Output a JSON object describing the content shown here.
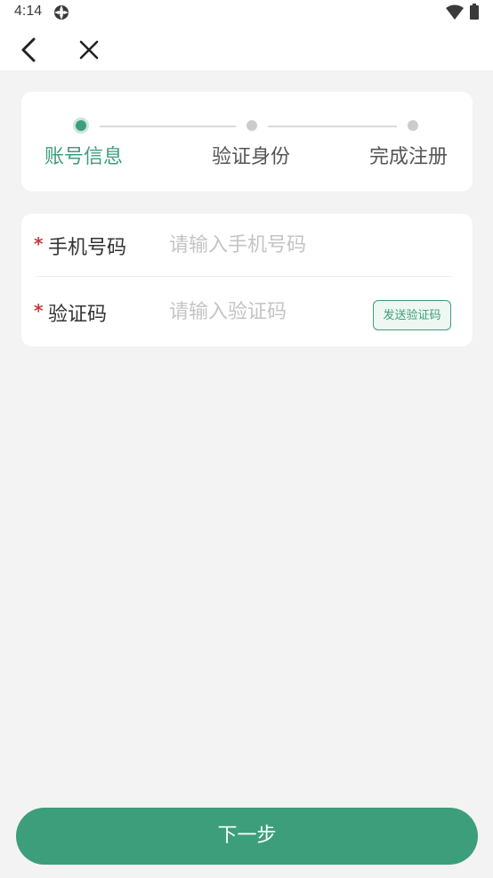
{
  "status_bar": {
    "time": "4:14"
  },
  "nav": {
    "back_icon": "chevron-left-icon",
    "close_icon": "close-icon"
  },
  "steps": [
    {
      "label": "账号信息",
      "state": "active"
    },
    {
      "label": "验证身份",
      "state": "pending"
    },
    {
      "label": "完成注册",
      "state": "pending"
    }
  ],
  "form": {
    "phone": {
      "required_mark": "*",
      "label": "手机号码",
      "placeholder": "请输入手机号码",
      "value": ""
    },
    "code": {
      "required_mark": "*",
      "label": "验证码",
      "placeholder": "请输入验证码",
      "value": "",
      "send_button_label": "发送验证码"
    }
  },
  "next_button_label": "下一步",
  "colors": {
    "accent": "#3d9e7b",
    "required": "#c63a3a",
    "background": "#f3f3f3",
    "placeholder": "#c4c4c4"
  }
}
